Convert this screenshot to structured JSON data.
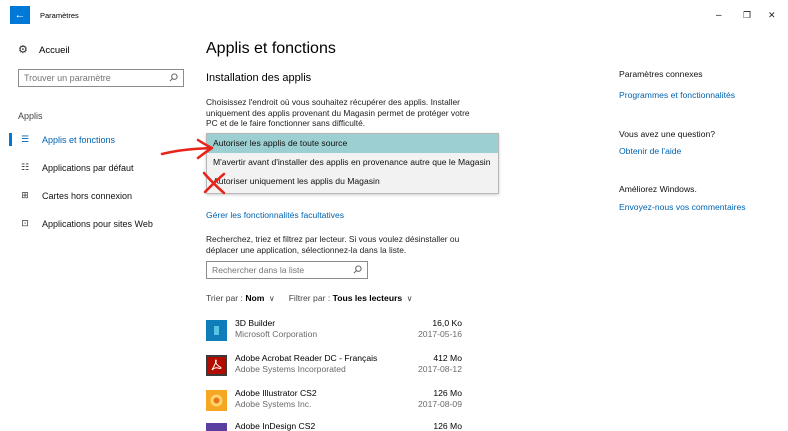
{
  "window": {
    "title": "Paramètres",
    "back_glyph": "←",
    "minimize_glyph": "–",
    "maximize_glyph": "❐",
    "close_glyph": "✕"
  },
  "nav": {
    "home_label": "Accueil",
    "search_placeholder": "Trouver un paramètre",
    "section_label": "Applis",
    "items": [
      {
        "label": "Applis et fonctions",
        "icon": "list-icon",
        "active": true
      },
      {
        "label": "Applications par défaut",
        "icon": "default-apps-icon",
        "active": false
      },
      {
        "label": "Cartes hors connexion",
        "icon": "map-icon",
        "active": false
      },
      {
        "label": "Applications pour sites Web",
        "icon": "web-apps-icon",
        "active": false
      }
    ]
  },
  "main": {
    "page_title": "Applis et fonctions",
    "install_title": "Installation des applis",
    "install_desc": "Choisissez l'endroit où vous souhaitez récupérer des applis. Installer uniquement des applis provenant du Magasin permet de protéger votre PC et de le faire fonctionner sans difficulté.",
    "dropdown_options": [
      "Autoriser les applis de toute source",
      "M'avertir avant d'installer des applis en provenance autre que le Magasin",
      "Autoriser uniquement les applis du Magasin"
    ],
    "optional_features_link": "Gérer les fonctionnalités facultatives",
    "list_desc": "Recherchez, triez et filtrez par lecteur. Si vous voulez désinstaller ou déplacer une application, sélectionnez-la dans la liste.",
    "list_search_placeholder": "Rechercher dans la liste",
    "sort_label": "Trier par :",
    "sort_value": "Nom",
    "filter_label": "Filtrer par :",
    "filter_value": "Tous les lecteurs",
    "apps": [
      {
        "name": "3D Builder",
        "publisher": "Microsoft Corporation",
        "size": "16,0 Ko",
        "date": "2017-05-16",
        "icon": "3d-builder-icon",
        "color": "#0f7dba"
      },
      {
        "name": "Adobe Acrobat Reader DC - Français",
        "publisher": "Adobe Systems Incorporated",
        "size": "412 Mo",
        "date": "2017-08-12",
        "icon": "acrobat-reader-icon",
        "color": "#b30b00"
      },
      {
        "name": "Adobe Illustrator CS2",
        "publisher": "Adobe Systems Inc.",
        "size": "126 Mo",
        "date": "2017-08-09",
        "icon": "illustrator-icon",
        "color": "#f5a623"
      },
      {
        "name": "Adobe InDesign CS2",
        "publisher": "",
        "size": "126 Mo",
        "date": "",
        "icon": "indesign-icon",
        "color": "#5b3fa0"
      }
    ]
  },
  "side": {
    "related_head": "Paramètres connexes",
    "related_link": "Programmes et fonctionnalités",
    "question_head": "Vous avez une question?",
    "question_link": "Obtenir de l'aide",
    "improve_head": "Améliorez Windows.",
    "improve_link": "Envoyez-nous vos commentaires"
  },
  "colors": {
    "accent": "#0078d7",
    "link": "#0063b1",
    "selected_option": "#9ccfd1",
    "annotation_red": "#e8231a"
  }
}
